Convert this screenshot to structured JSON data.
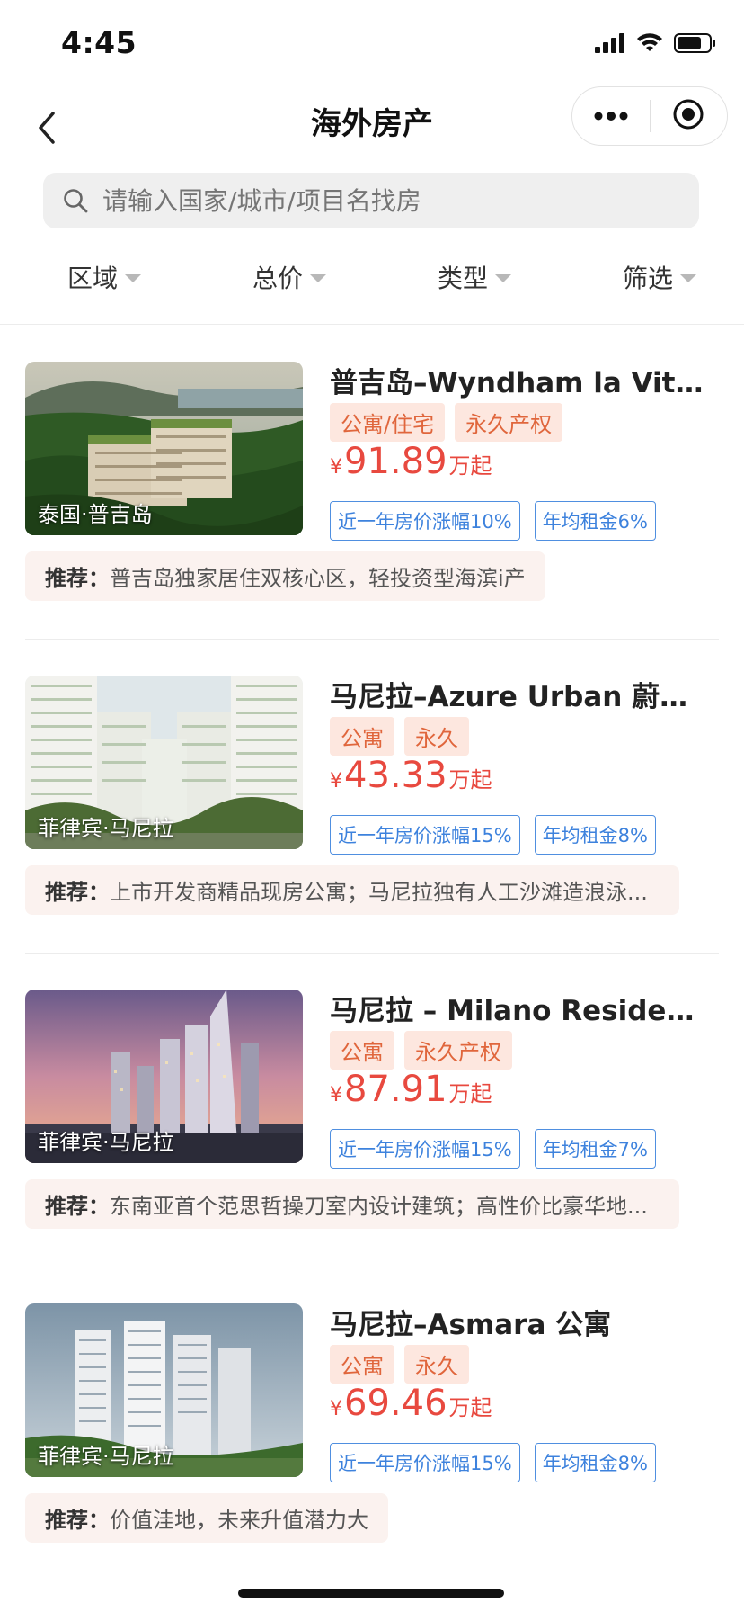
{
  "status_bar": {
    "time": "4:45"
  },
  "nav": {
    "title": "海外房产"
  },
  "search": {
    "placeholder": "请输入国家/城市/项目名找房"
  },
  "filters": [
    "区域",
    "总价",
    "类型",
    "筛选"
  ],
  "listings": [
    {
      "title": "普吉岛–Wyndham la Vita ...",
      "tags": [
        "公寓/住宅",
        "永久产权"
      ],
      "price_symbol": "¥",
      "price": "91.89",
      "price_unit": "万起",
      "badges": [
        "近一年房价涨幅10%",
        "年均租金6%"
      ],
      "location": "泰国·普吉岛",
      "rec_label": "推荐：",
      "rec_text": "普吉岛独家居住双核心区，轻投资型海滨i产"
    },
    {
      "title": "马尼拉–Azure Urban 蔚蓝...",
      "tags": [
        "公寓",
        "永久"
      ],
      "price_symbol": "¥",
      "price": "43.33",
      "price_unit": "万起",
      "badges": [
        "近一年房价涨幅15%",
        "年均租金8%"
      ],
      "location": "菲律宾·马尼拉",
      "rec_label": "推荐：",
      "rec_text": "上市开发商精品现房公寓；马尼拉独有人工沙滩造浪泳..."
    },
    {
      "title": "马尼拉 – Milano Residenc...",
      "tags": [
        "公寓",
        "永久产权"
      ],
      "price_symbol": "¥",
      "price": "87.91",
      "price_unit": "万起",
      "badges": [
        "近一年房价涨幅15%",
        "年均租金7%"
      ],
      "location": "菲律宾·马尼拉",
      "rec_label": "推荐：",
      "rec_text": "东南亚首个范思哲操刀室内设计建筑；高性价比豪华地..."
    },
    {
      "title": "马尼拉–Asmara 公寓",
      "tags": [
        "公寓",
        "永久"
      ],
      "price_symbol": "¥",
      "price": "69.46",
      "price_unit": "万起",
      "badges": [
        "近一年房价涨幅15%",
        "年均租金8%"
      ],
      "location": "菲律宾·马尼拉",
      "rec_label": "推荐：",
      "rec_text": "价值洼地，未来升值潜力大"
    }
  ],
  "icons": {
    "back": "chevron-left-icon",
    "more": "more-dots-icon",
    "close": "target-circle-icon",
    "search": "search-icon",
    "filter_arrow": "triangle-down-icon"
  },
  "colors": {
    "price": "#e8493f",
    "tag_bg": "#fde7df",
    "tag_text": "#e0663c",
    "badge_border": "#4f8fe0",
    "rec_bg": "#fbf2ef"
  }
}
